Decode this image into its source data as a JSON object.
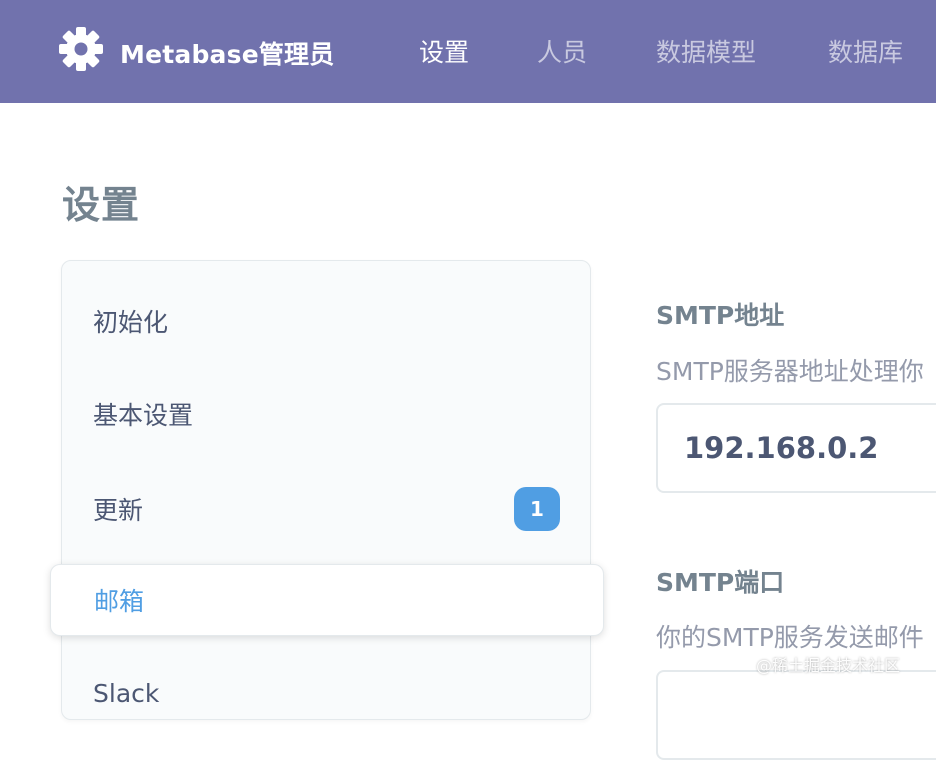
{
  "navbar": {
    "brand": "Metabase管理员",
    "items": [
      {
        "label": "设置",
        "active": true
      },
      {
        "label": "人员",
        "active": false
      },
      {
        "label": "数据模型",
        "active": false
      },
      {
        "label": "数据库",
        "active": false
      }
    ]
  },
  "page": {
    "title": "设置"
  },
  "sidebar": {
    "items": [
      {
        "label": "初始化"
      },
      {
        "label": "基本设置"
      },
      {
        "label": "更新",
        "badge": "1"
      },
      {
        "label": "邮箱",
        "selected": true
      },
      {
        "label": "Slack"
      }
    ]
  },
  "settings": {
    "smtp_host": {
      "label": "SMTP地址",
      "description": "SMTP服务器地址处理你",
      "value": "192.168.0.2"
    },
    "smtp_port": {
      "label": "SMTP端口",
      "description": "你的SMTP服务发送邮件"
    }
  },
  "watermark": "@稀土掘金技术社区",
  "colors": {
    "navbar": "#7172ad",
    "accent": "#509ee3",
    "text": "#4c5773",
    "muted": "#74838f"
  }
}
